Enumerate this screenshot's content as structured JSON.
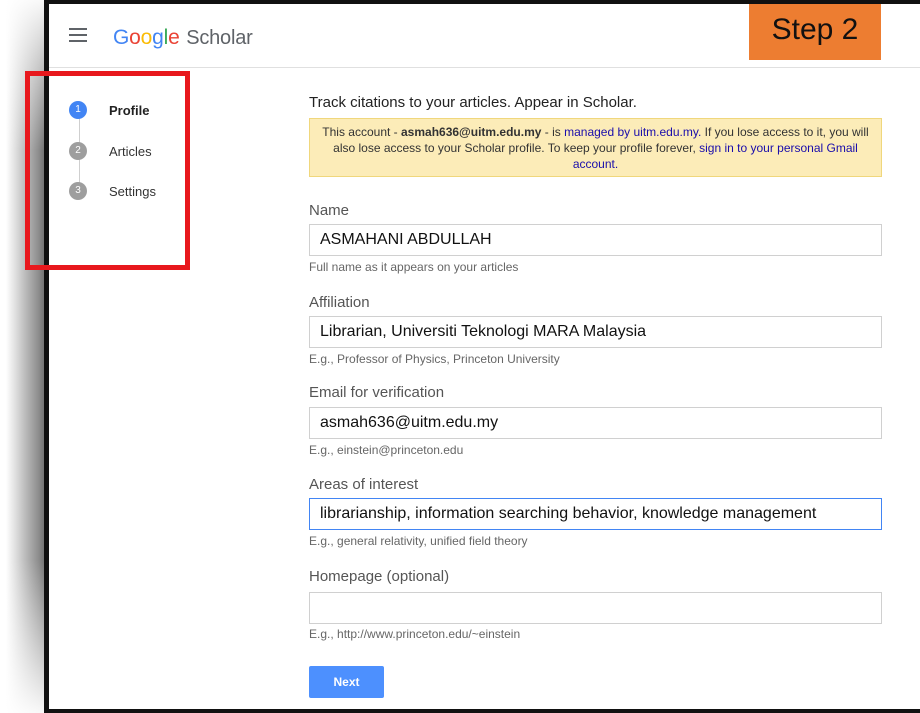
{
  "header": {
    "logo_parts": [
      "G",
      "o",
      "o",
      "g",
      "l",
      "e"
    ],
    "logo_suffix": "Scholar",
    "menu_icon": "hamburger-menu-icon"
  },
  "banner": {
    "label": "Step 2",
    "color": "#ed7d31"
  },
  "steps": [
    {
      "number": "1",
      "label": "Profile",
      "active": true
    },
    {
      "number": "2",
      "label": "Articles",
      "active": false
    },
    {
      "number": "3",
      "label": "Settings",
      "active": false
    }
  ],
  "form": {
    "intro": "Track citations to your articles. Appear in Scholar.",
    "notice": {
      "prefix": "This account - ",
      "email": "asmah636@uitm.edu.my",
      "middle": " - is ",
      "link1": "managed by uitm.edu.my.",
      "text": " If you lose access to it, you will also lose access to your Scholar profile. To keep your profile forever, ",
      "link2": "sign in to your personal Gmail account."
    },
    "fields": [
      {
        "label": "Name",
        "value": "ASMAHANI ABDULLAH",
        "help": "Full name as it appears on your articles"
      },
      {
        "label": "Affiliation",
        "value": "Librarian, Universiti Teknologi MARA Malaysia",
        "help": "E.g., Professor of Physics, Princeton University"
      },
      {
        "label": "Email for verification",
        "value": "asmah636@uitm.edu.my",
        "help": "E.g., einstein@princeton.edu"
      },
      {
        "label": "Areas of interest",
        "value": "librarianship, information searching behavior, knowledge management",
        "help": "E.g., general relativity, unified field theory"
      },
      {
        "label": "Homepage (optional)",
        "value": "",
        "help": "E.g., http://www.princeton.edu/~einstein"
      }
    ],
    "next_label": "Next"
  },
  "colors": {
    "accent": "#4285f4",
    "button": "#4d90fe",
    "notice_bg": "#fcecb8",
    "highlight_box": "#e8181d"
  }
}
